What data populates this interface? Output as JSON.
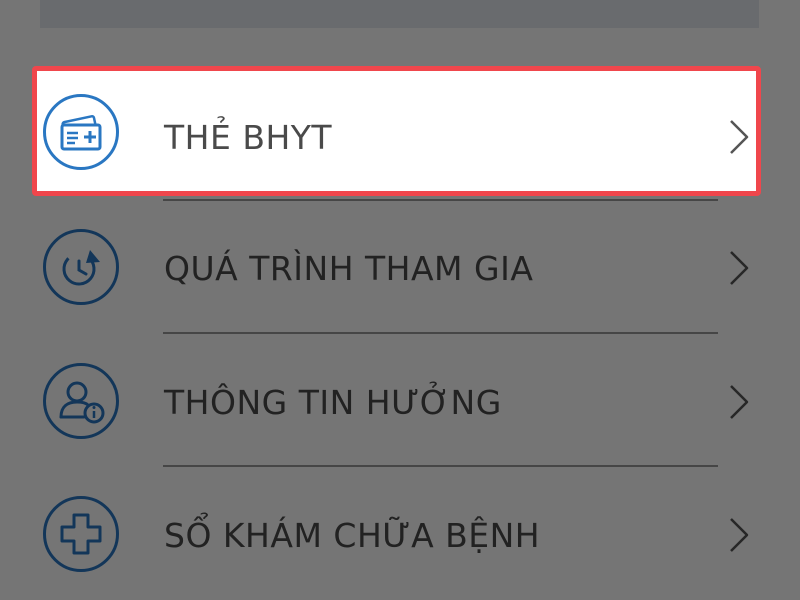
{
  "menu": {
    "items": [
      {
        "label": "THẺ BHYT",
        "icon": "health-card-icon",
        "highlighted": true
      },
      {
        "label": "QUÁ TRÌNH THAM GIA",
        "icon": "history-clock-icon"
      },
      {
        "label": "THÔNG TIN HƯỞNG",
        "icon": "user-info-icon"
      },
      {
        "label": "SỔ KHÁM CHỮA BỆNH",
        "icon": "medical-cross-icon"
      }
    ]
  },
  "colors": {
    "accent_blue": "#2a77c2",
    "highlight_border": "#f0464c",
    "label_text": "#4a4a4a",
    "overlay": "rgba(0,0,0,0.54)"
  }
}
